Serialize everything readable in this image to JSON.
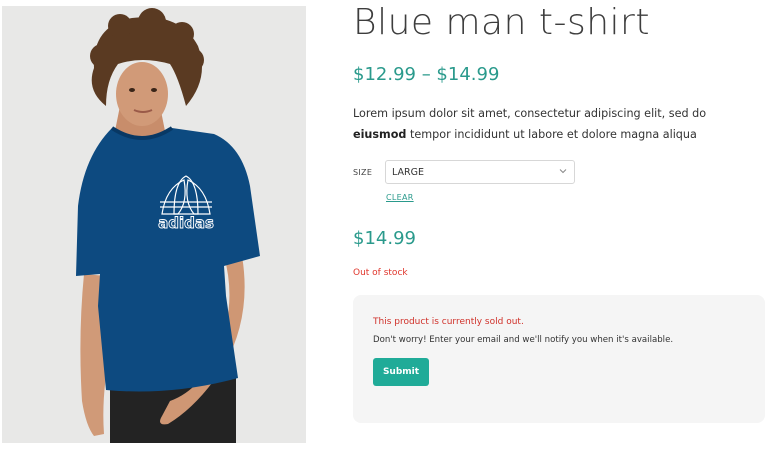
{
  "product": {
    "title": "Blue man t-shirt",
    "price_range": "$12.99 – $14.99",
    "description_before": "Lorem ipsum dolor sit amet, consectetur adipiscing elit, sed do ",
    "description_bold": "eiusmod",
    "description_after": " tempor incididunt ut labore et dolore magna aliqua",
    "image_logo_text": "adidas"
  },
  "variation": {
    "size_label": "SIZE",
    "selected_size": "LARGE",
    "clear_label": "CLEAR"
  },
  "selected_price": "$14.99",
  "stock_status": "Out of stock",
  "notify": {
    "sold_out_text": "This product is currently sold out.",
    "message": "Don't worry! Enter your email and we'll notify you when it's available.",
    "submit_label": "Submit"
  },
  "colors": {
    "accent": "#2a9a8c",
    "button": "#20ab98",
    "error": "#e0362c",
    "shirt": "#0d4a80"
  }
}
